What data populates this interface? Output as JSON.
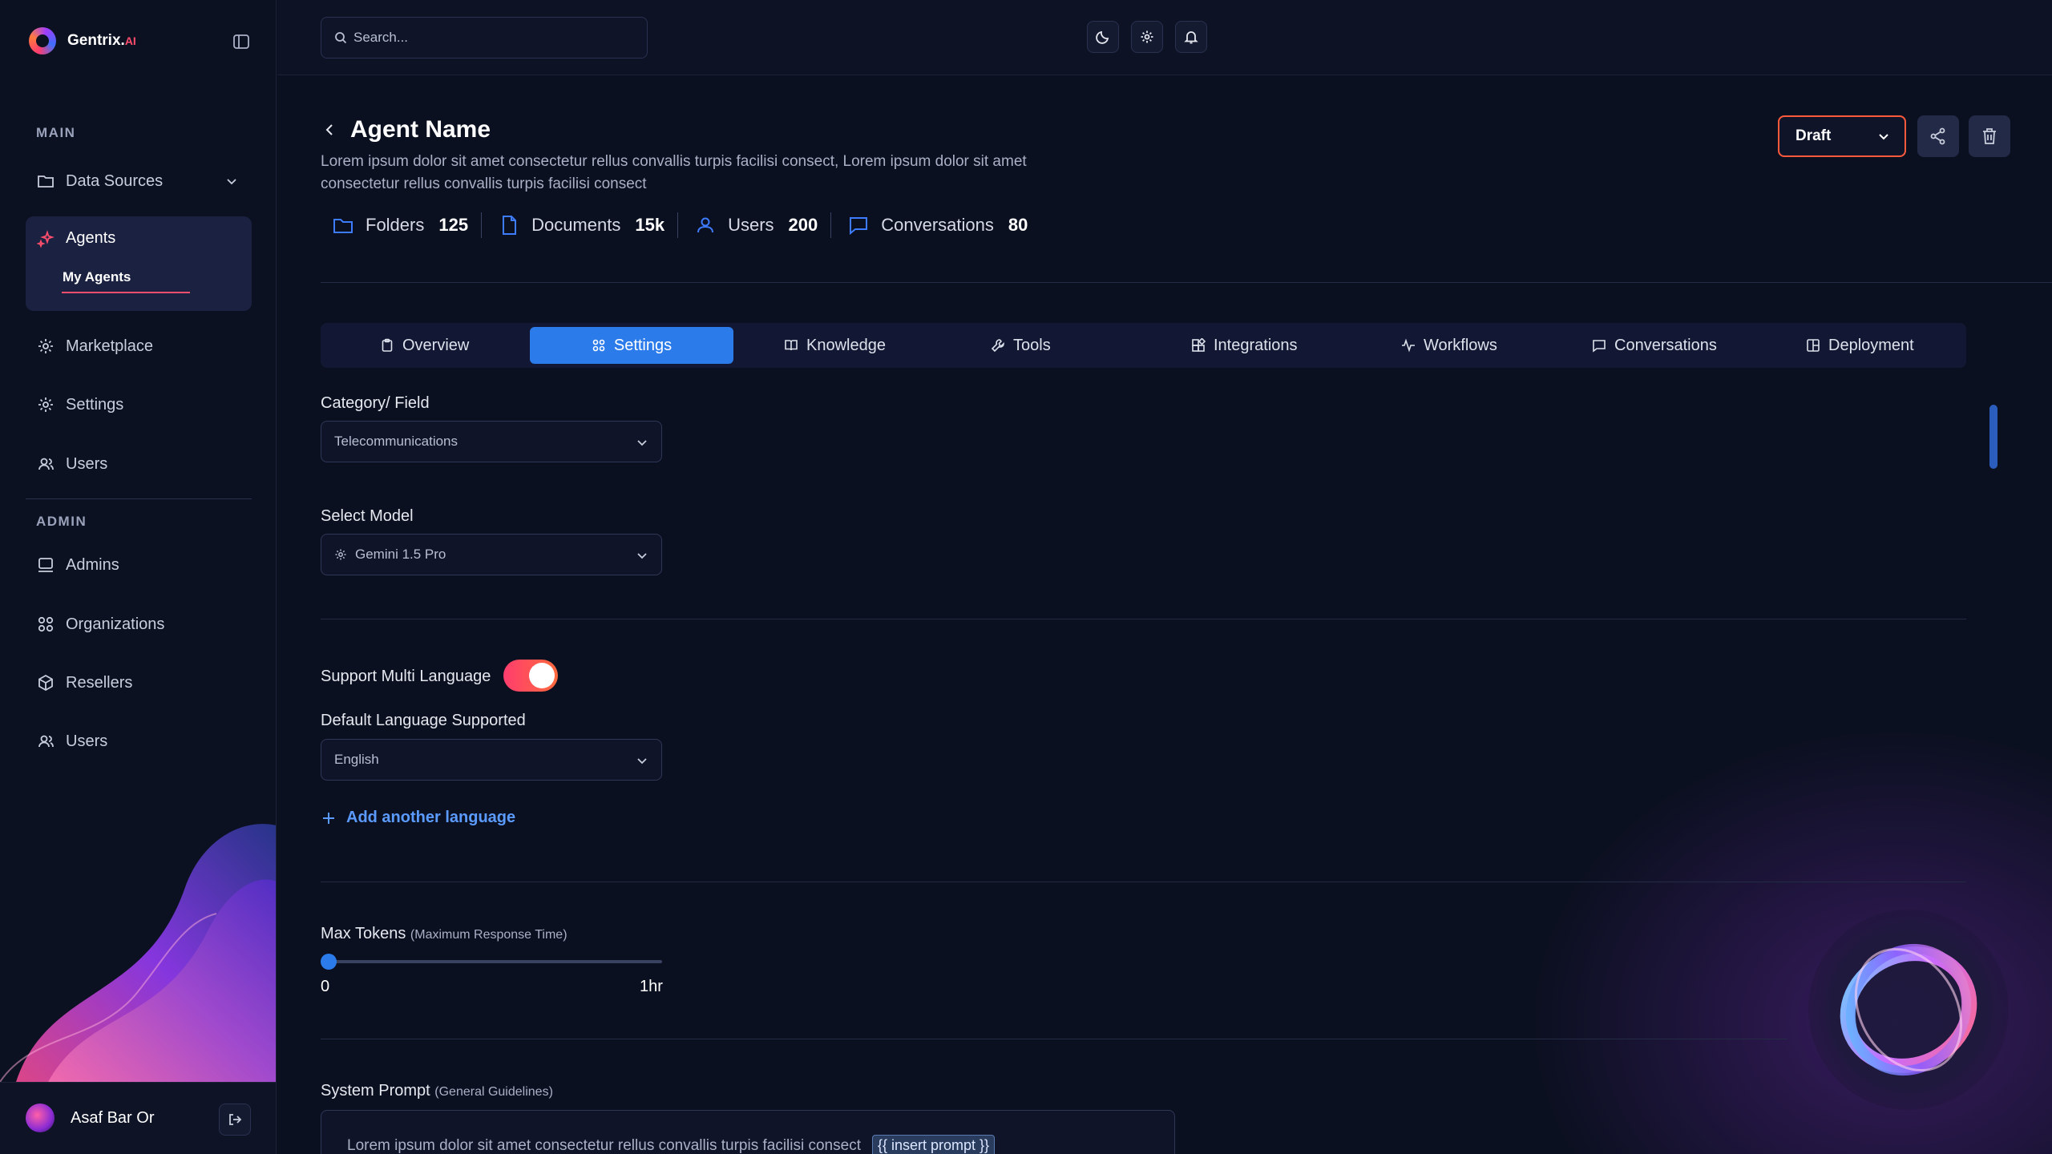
{
  "brand": {
    "name": "Gentrix.",
    "suffix": "AI"
  },
  "sidebar": {
    "main_label": "MAIN",
    "admin_label": "ADMIN",
    "data_sources": "Data Sources",
    "agents": "Agents",
    "my_agents": "My Agents",
    "marketplace": "Marketplace",
    "settings": "Settings",
    "users": "Users",
    "admins": "Admins",
    "organizations": "Organizations",
    "resellers": "Resellers",
    "admin_users": "Users",
    "user_name": "Asaf Bar Or"
  },
  "topbar": {
    "search_placeholder": "Search..."
  },
  "agent": {
    "title": "Agent Name",
    "description": "Lorem ipsum dolor sit amet consectetur rellus convallis turpis facilisi consect, Lorem ipsum dolor sit amet consectetur rellus convallis turpis facilisi consect",
    "status": "Draft"
  },
  "stats": [
    {
      "label": "Folders",
      "value": "125"
    },
    {
      "label": "Documents",
      "value": "15k"
    },
    {
      "label": "Users",
      "value": "200"
    },
    {
      "label": "Conversations",
      "value": "80"
    }
  ],
  "tabs": [
    "Overview",
    "Settings",
    "Knowledge",
    "Tools",
    "Integrations",
    "Workflows",
    "Conversations",
    "Deployment"
  ],
  "active_tab": "Settings",
  "form": {
    "category_label": "Category/ Field",
    "category_value": "Telecommunications",
    "model_label": "Select Model",
    "model_value": "Gemini 1.5 Pro",
    "multi_lang_label": "Support Multi Language",
    "multi_lang_enabled": true,
    "default_lang_label": "Default Language Supported",
    "default_lang_value": "English",
    "add_language": "Add another language",
    "max_tokens_label": "Max Tokens",
    "max_tokens_hint": "(Maximum Response Time)",
    "max_tokens_min": "0",
    "max_tokens_max": "1hr",
    "max_tokens_value": 0,
    "system_prompt_label": "System Prompt",
    "system_prompt_hint": "(General Guidelines)",
    "system_prompt_text": "Lorem ipsum dolor sit amet consectetur rellus convallis turpis facilisi consect",
    "system_prompt_chip": "{{ insert prompt }}"
  },
  "colors": {
    "accent": "#2b7bea",
    "brand": "#ff4d6d",
    "toggle": "#ff3d6e",
    "background": "#0b1020"
  }
}
